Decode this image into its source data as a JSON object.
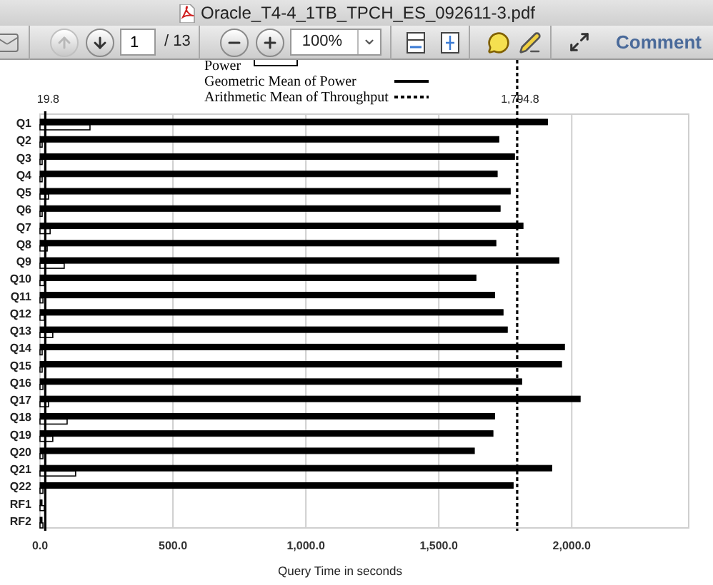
{
  "window": {
    "title": "Oracle_T4-4_1TB_TPCH_ES_092611-3.pdf"
  },
  "toolbar": {
    "previous_page": {
      "disabled": true
    },
    "next_page": {
      "disabled": false
    },
    "page_input": {
      "value": "1"
    },
    "page_total": "/ 13",
    "zoom_field": {
      "value": "100%"
    },
    "comment_button": "Comment"
  },
  "chart_data": {
    "type": "bar",
    "orientation": "horizontal",
    "xlabel": "Query Time in seconds",
    "grid": true,
    "categories": [
      "Q1",
      "Q2",
      "Q3",
      "Q4",
      "Q5",
      "Q6",
      "Q7",
      "Q8",
      "Q9",
      "Q10",
      "Q11",
      "Q12",
      "Q13",
      "Q14",
      "Q15",
      "Q16",
      "Q17",
      "Q18",
      "Q19",
      "Q20",
      "Q21",
      "Q22",
      "RF1",
      "RF2"
    ],
    "series": [
      {
        "color": "#000000",
        "values": [
          1909,
          1726,
          1785,
          1720,
          1769,
          1731,
          1817,
          1715,
          1952,
          1640,
          1710,
          1742,
          1758,
          1973,
          1962,
          1812,
          2032,
          1710,
          1704,
          1634,
          1925,
          1780,
          8,
          6
        ]
      },
      {
        "name": "Power",
        "color": "#ffffff",
        "values": [
          188,
          3,
          2,
          2,
          32,
          2,
          38,
          27,
          91,
          16,
          11,
          16,
          48,
          5,
          5,
          11,
          32,
          102,
          48,
          11,
          134,
          11,
          16,
          11
        ]
      }
    ],
    "xlim": [
      0,
      2440
    ],
    "xticks": [
      {
        "value": 0,
        "label": "0.0"
      },
      {
        "value": 500,
        "label": "500.0"
      },
      {
        "value": 1000,
        "label": "1,000.0"
      },
      {
        "value": 1500,
        "label": "1,500.0"
      },
      {
        "value": 2000,
        "label": "2,000.0"
      }
    ],
    "ref_lines": [
      {
        "axis": "x",
        "value": 19.8,
        "label": "19.8"
      },
      {
        "axis": "x",
        "value": 1794.8,
        "label": "1,794.8"
      }
    ]
  },
  "legend": [
    {
      "label": "Geometric Mean of Power",
      "kind": "solid"
    },
    {
      "label": "Arithmetic Mean of Throughput",
      "kind": "dotted"
    }
  ]
}
